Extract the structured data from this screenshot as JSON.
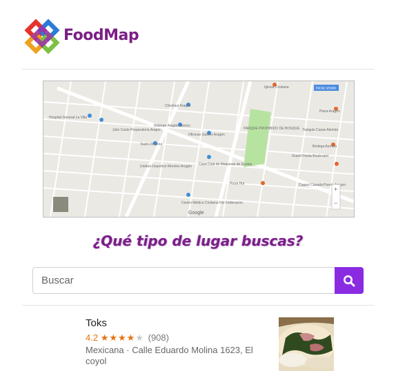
{
  "app": {
    "name": "FoodMap",
    "brand_color": "#7b1f86",
    "accent_color": "#8a2be2"
  },
  "map": {
    "labels": [
      "Hospital General La Villa",
      "Chedraui Aragón",
      "Walmart Aragón Mexico",
      "Julio Caste Preparatoria Aragón",
      "Oficinas Gasver Aragón",
      "Teatro Moreno",
      "Unidad Deportivo Morelos Aragón",
      "Casa Club de Maquinas de Ecatep",
      "PARQUE PROHIBIDO DE BOSQUE",
      "Pizza Hut",
      "Tianguis Casas Alemán",
      "Grand Fiesta Boulevard",
      "Bodega Aurrera",
      "Coppel Canada Puerto Aragon",
      "Centro Médico Cristiana Rio Federación",
      "Iglesia Cristiana",
      "Plaza Aragón"
    ],
    "btn_label": "Iniciar sesión",
    "google_label": "Google"
  },
  "question": "¿Qué tipo de lugar buscas?",
  "search": {
    "placeholder": "Buscar",
    "button_icon": "search-icon"
  },
  "results": [
    {
      "name": "Toks",
      "rating": "4.2",
      "rating_value": 4.2,
      "stars_filled": "★★★★",
      "stars_empty": "★",
      "review_count": "(908)",
      "address": "Mexicana · Calle Eduardo Molina 1623, El coyol"
    }
  ]
}
